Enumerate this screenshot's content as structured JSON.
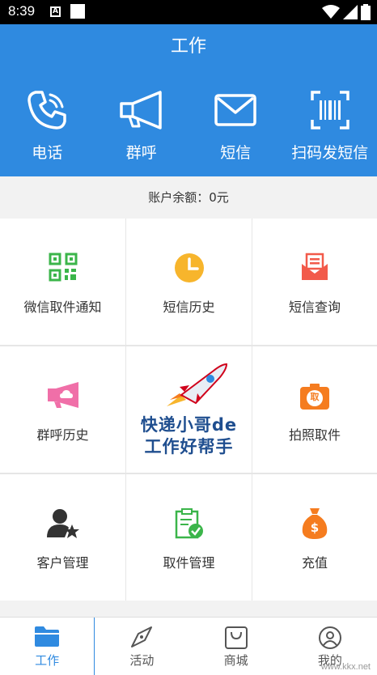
{
  "status_bar": {
    "time": "8:39",
    "a_icon": "A"
  },
  "header": {
    "title": "工作"
  },
  "quick_actions": [
    {
      "label": "电话",
      "icon": "phone-icon"
    },
    {
      "label": "群呼",
      "icon": "megaphone-icon"
    },
    {
      "label": "短信",
      "icon": "envelope-icon"
    },
    {
      "label": "扫码发短信",
      "icon": "barcode-scan-icon"
    }
  ],
  "balance": {
    "text": "账户余额：0元"
  },
  "grid": {
    "wechat_notify": {
      "label": "微信取件通知",
      "icon": "qr-code-icon",
      "color": "#3bb54a"
    },
    "sms_history": {
      "label": "短信历史",
      "icon": "clock-icon",
      "color": "#f7b52c"
    },
    "sms_query": {
      "label": "短信查询",
      "icon": "mail-document-icon",
      "color": "#f25a4a"
    },
    "group_call_history": {
      "label": "群呼历史",
      "icon": "megaphone-cloud-icon",
      "color": "#f06fa8"
    },
    "banner": {
      "line1": "快递小哥de",
      "line2": "工作好帮手"
    },
    "photo_pickup": {
      "label": "拍照取件",
      "icon": "camera-icon",
      "color": "#f57c1f",
      "badge": "取"
    },
    "customer_manage": {
      "label": "客户管理",
      "icon": "user-star-icon",
      "color": "#333333"
    },
    "pickup_manage": {
      "label": "取件管理",
      "icon": "clipboard-check-icon",
      "color": "#3bb54a"
    },
    "recharge": {
      "label": "充值",
      "icon": "money-bag-icon",
      "color": "#f57c1f",
      "badge": "$"
    }
  },
  "tabs": [
    {
      "label": "工作",
      "icon": "folder-icon",
      "active": true
    },
    {
      "label": "活动",
      "icon": "compass-icon",
      "active": false
    },
    {
      "label": "商城",
      "icon": "shopping-bag-icon",
      "active": false
    },
    {
      "label": "我的",
      "icon": "profile-icon",
      "active": false
    }
  ],
  "watermark": "www.kkx.net",
  "colors": {
    "primary": "#2f8ae0",
    "background": "#f2f2f2"
  }
}
